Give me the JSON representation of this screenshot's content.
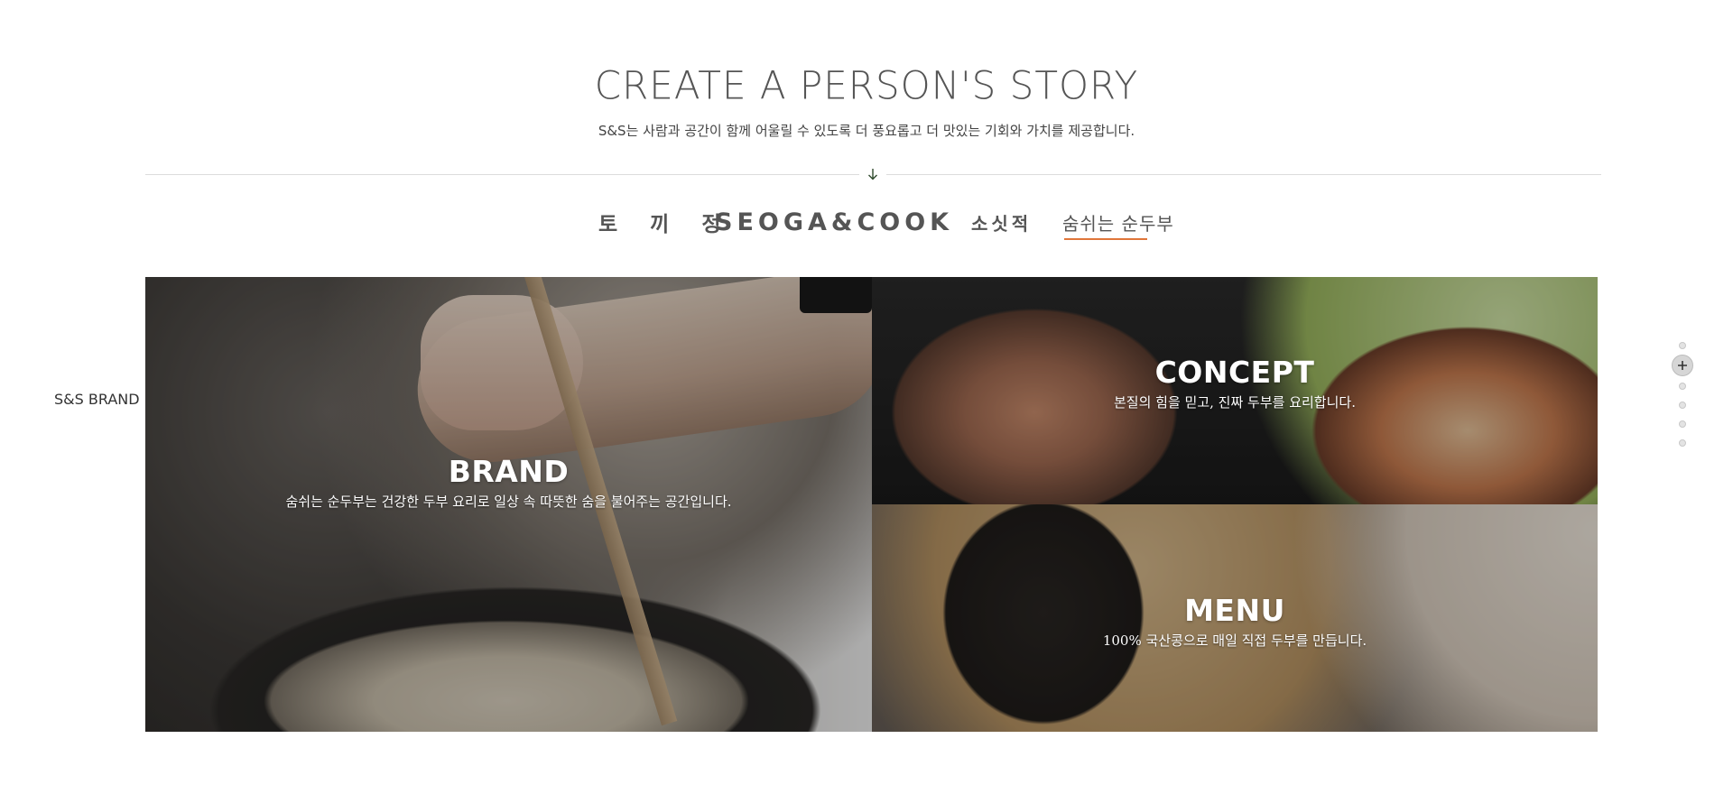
{
  "hero": {
    "title": "CREATE A PERSON'S STORY",
    "subtitle": "S&S는 사람과 공간이 함께 어울릴 수 있도록 더 풍요롭고 더 맛있는 기회와 가치를 제공합니다."
  },
  "divider": {
    "icon": "arrow-down-icon"
  },
  "brand_tabs": [
    {
      "label": "토 끼 정",
      "active": false
    },
    {
      "label": "SEOGA&COOK",
      "active": false
    },
    {
      "label": "소싯적",
      "active": false
    },
    {
      "label": "숨쉬는 순두부",
      "active": true
    }
  ],
  "side_label": "S&S BRAND",
  "panels": {
    "brand": {
      "title": "BRAND",
      "subtitle": "숨쉬는 순두부는 건강한 두부 요리로 일상 속 따뜻한 숨을 불어주는 공간입니다."
    },
    "concept": {
      "title": "CONCEPT",
      "subtitle": "본질의 힘을 믿고, 진짜 두부를 요리합니다."
    },
    "menu": {
      "title": "MENU",
      "subtitle": "100% 국산콩으로 매일 직접 두부를 만듭니다."
    }
  },
  "pager": {
    "count": 6,
    "active_index": 1,
    "active_icon": "plus-icon"
  },
  "colors": {
    "accent": "#e0763a",
    "text": "#333333",
    "divider": "#dcdcdc"
  }
}
